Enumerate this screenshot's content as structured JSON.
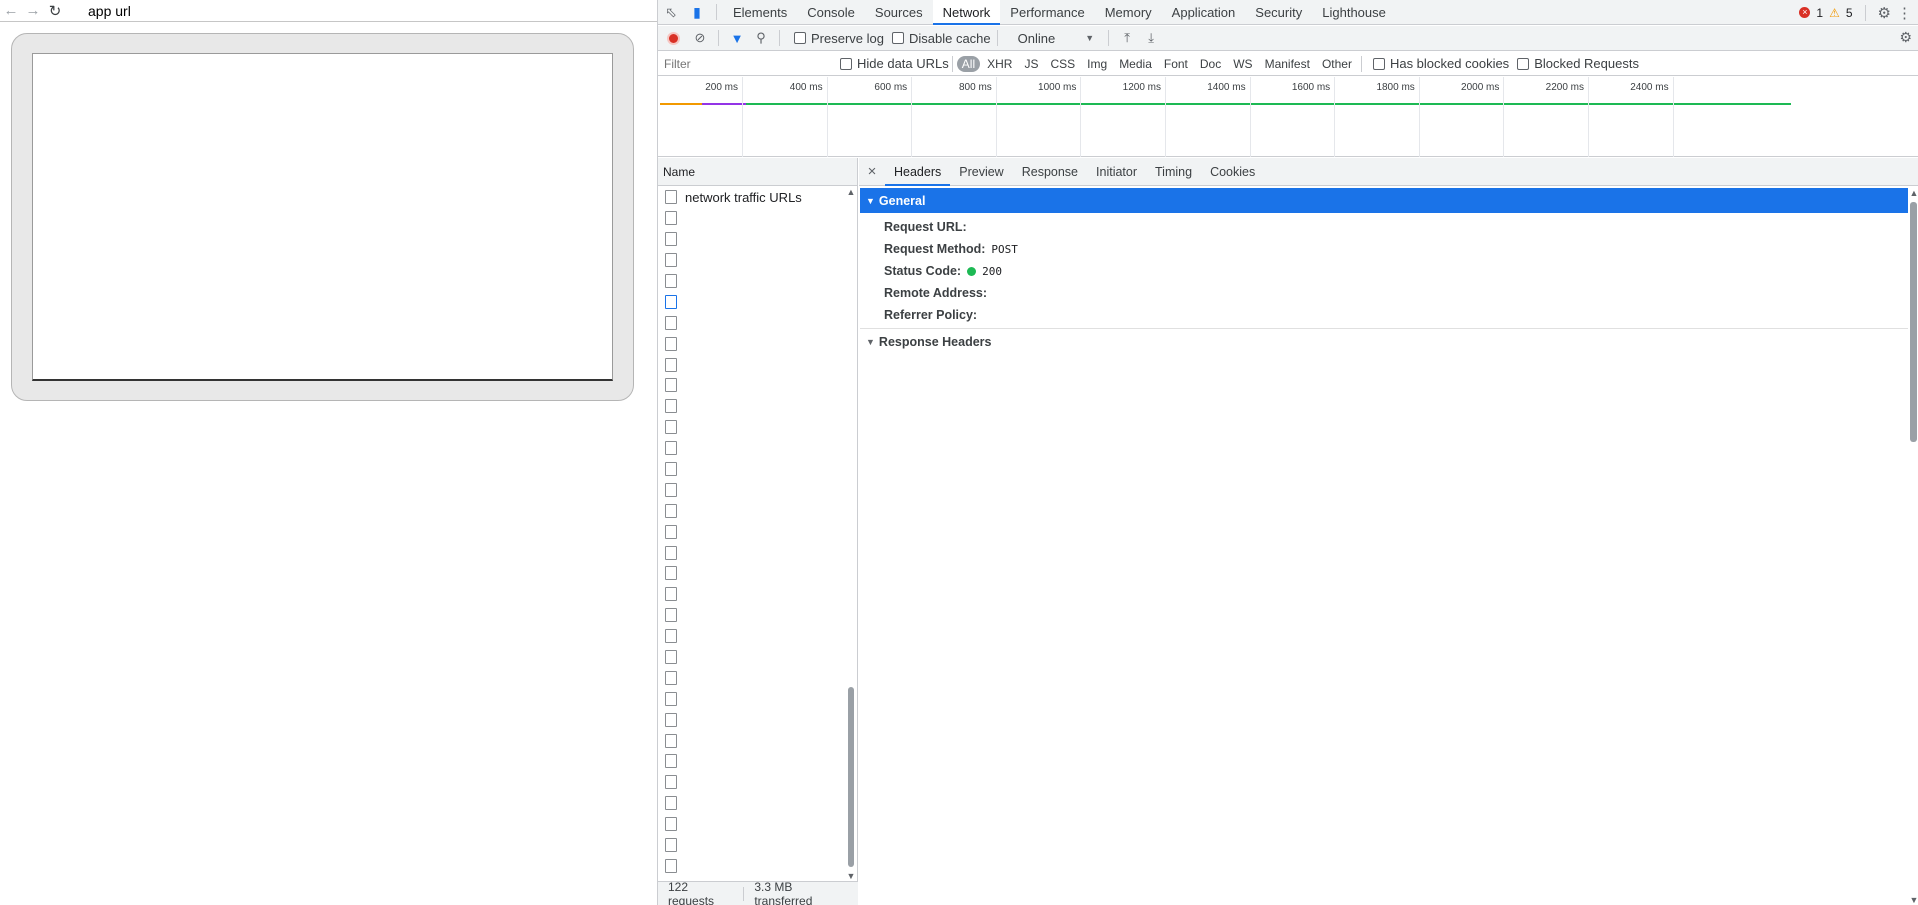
{
  "browser": {
    "app_url": "app url"
  },
  "devtools": {
    "tabs": [
      "Elements",
      "Console",
      "Sources",
      "Network",
      "Performance",
      "Memory",
      "Application",
      "Security",
      "Lighthouse"
    ],
    "active_tab": "Network",
    "error_count": "1",
    "warning_count": "5",
    "toolbar": {
      "preserve_log": "Preserve log",
      "disable_cache": "Disable cache",
      "throttle": "Online"
    },
    "filter": {
      "placeholder": "Filter",
      "hide_data_urls": "Hide data URLs",
      "types": [
        "All",
        "XHR",
        "JS",
        "CSS",
        "Img",
        "Media",
        "Font",
        "Doc",
        "WS",
        "Manifest",
        "Other"
      ],
      "active_type": "All",
      "has_blocked_cookies": "Has blocked cookies",
      "blocked_requests": "Blocked Requests"
    },
    "overview": {
      "ticks": [
        "200 ms",
        "400 ms",
        "600 ms",
        "800 ms",
        "1000 ms",
        "1200 ms",
        "1400 ms",
        "1600 ms",
        "1800 ms",
        "2000 ms",
        "2200 ms",
        "2400 ms"
      ]
    },
    "requests": {
      "column_name": "Name",
      "first_row_label": "network traffic URLs",
      "row_count_visible": 33,
      "summary_requests": "122 requests",
      "summary_transferred": "3.3 MB transferred"
    },
    "details": {
      "tabs": [
        "Headers",
        "Preview",
        "Response",
        "Initiator",
        "Timing",
        "Cookies"
      ],
      "active_tab": "Headers",
      "general_title": "General",
      "request_url_label": "Request URL:",
      "request_method_label": "Request Method:",
      "request_method_value": "POST",
      "status_code_label": "Status Code:",
      "status_code_value": "200",
      "remote_address_label": "Remote Address:",
      "referrer_policy_label": "Referrer Policy:",
      "response_headers_title": "Response Headers"
    }
  }
}
